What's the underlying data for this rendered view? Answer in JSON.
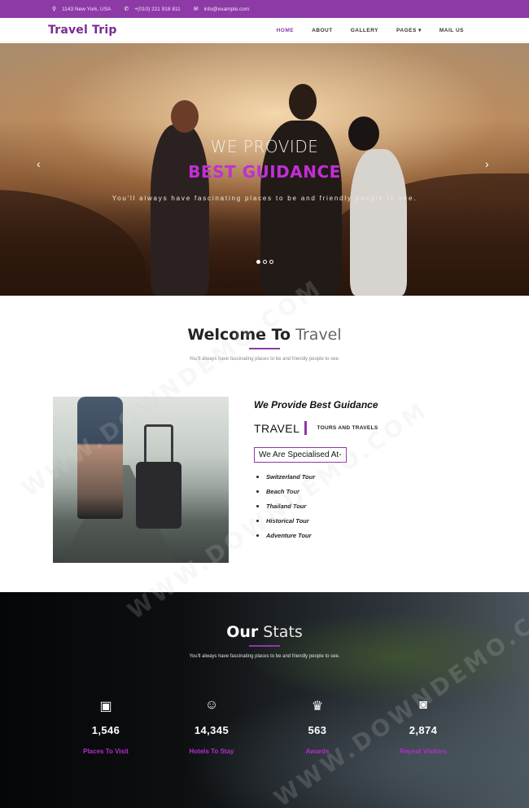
{
  "topbar": {
    "address": "1143 New York, USA",
    "phone": "+(010) 221 918 811",
    "email": "info@example.com"
  },
  "nav": {
    "brand": "Travel Trip",
    "items": [
      "HOME",
      "ABOUT",
      "GALLERY",
      "PAGES",
      "MAIL US"
    ],
    "active": "HOME"
  },
  "hero": {
    "line1": "WE PROVIDE",
    "line2": "BEST GUIDANCE",
    "subtitle": "You'll always have fascinating places to be and friendly people to see.",
    "prev_icon": "chevron-left-icon",
    "next_icon": "chevron-right-icon",
    "active_slide": 1,
    "slide_count": 3
  },
  "welcome": {
    "title_bold": "Welcome To",
    "title_light": "Travel",
    "subtitle": "You'll always have fascinating places to be and friendly people to see."
  },
  "about": {
    "heading": "We Provide Best Guidance",
    "travel": "TRAVEL",
    "tagline": "TOURS AND TRAVELS",
    "specialised": "We Are Specialised At-",
    "tours": [
      "Switzerland Tour",
      "Beach Tour",
      "Thailand Tour",
      "Historical Tour",
      "Adventure Tour"
    ]
  },
  "stats": {
    "title_bold": "Our",
    "title_light": "Stats",
    "subtitle": "You'll always have fascinating places to be and friendly people to see.",
    "items": [
      {
        "icon": "image-icon",
        "number": "1,546",
        "label": "Places To Visit"
      },
      {
        "icon": "smile-icon",
        "number": "14,345",
        "label": "Hotels To Stay"
      },
      {
        "icon": "trophy-icon",
        "number": "563",
        "label": "Awards"
      },
      {
        "icon": "camera-icon",
        "number": "2,874",
        "label": "Repeat Visitors"
      }
    ]
  },
  "watermark": "WWW.DOWNDEMO.COM",
  "colors": {
    "accent": "#8d3aa7",
    "hero_highlight": "#c12fd6",
    "stat_label": "#b12fc8"
  }
}
